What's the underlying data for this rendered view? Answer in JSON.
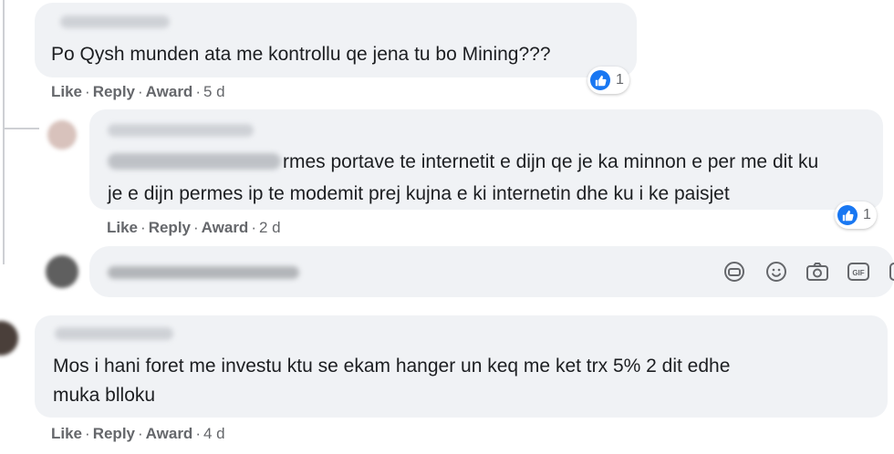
{
  "comments": [
    {
      "text": "Po Qysh munden ata me kontrollu qe jena tu bo Mining???",
      "actions": {
        "like": "Like",
        "reply": "Reply",
        "award": "Award",
        "time": "5 d"
      },
      "reaction_count": "1"
    },
    {
      "line1": "rmes portave te internetit e dijn qe je ka minnon e per me dit ku",
      "line2": "je e dijn permes ip te modemit prej kujna e ki internetin dhe ku i ke paisjet",
      "actions": {
        "like": "Like",
        "reply": "Reply",
        "award": "Award",
        "time": "2 d"
      },
      "reaction_count": "1"
    },
    {
      "line1": "Mos i hani foret me investu ktu se ekam hanger un keq me ket trx 5% 2 dit edhe",
      "line2": "muka blloku",
      "actions": {
        "like": "Like",
        "reply": "Reply",
        "award": "Award",
        "time": "4 d"
      }
    }
  ],
  "separator": "·",
  "reply_toolbar_icons": [
    "sticker-icon",
    "emoji-icon",
    "camera-icon",
    "gif-icon",
    "more-sticker-icon"
  ],
  "colors": {
    "like_blue": "#1877f2",
    "bubble_bg": "#f0f2f5",
    "meta_gray": "#65676b"
  }
}
